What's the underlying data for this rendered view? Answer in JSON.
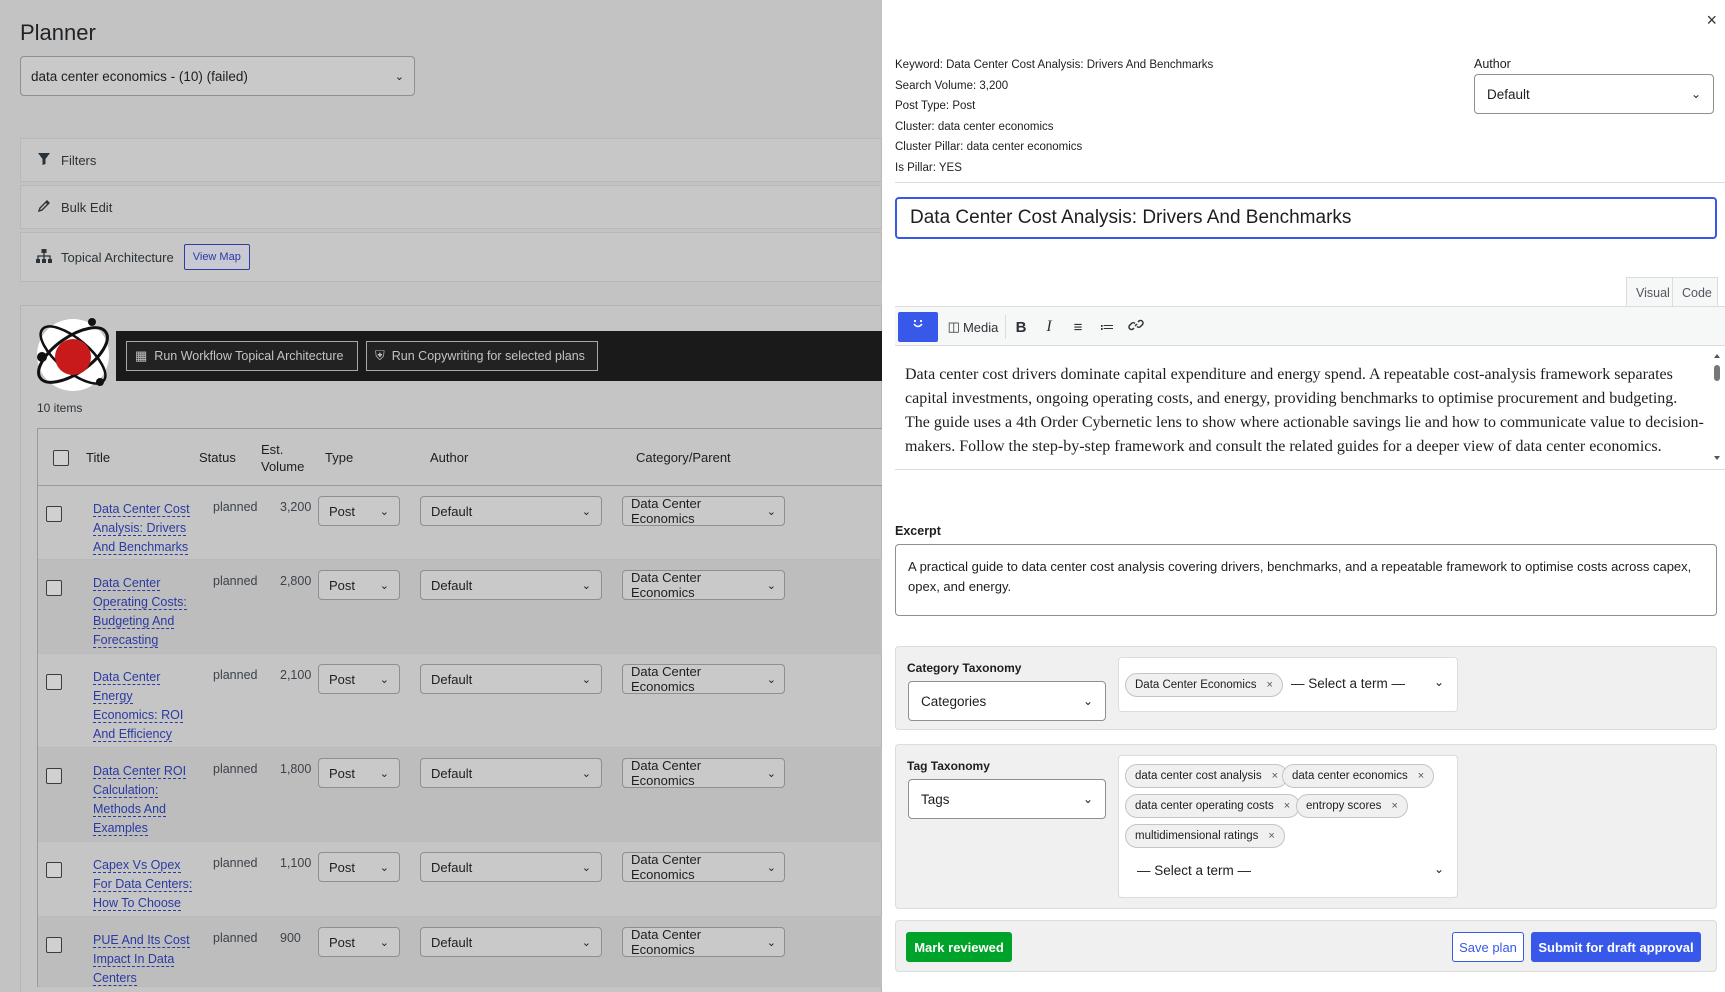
{
  "planner": {
    "title": "Planner",
    "plan_select": "data center economics - (10) (failed)",
    "filters_label": "Filters",
    "bulk_edit_label": "Bulk Edit",
    "topical_label": "Topical Architecture",
    "view_map_label": "View Map",
    "run_workflow_label": "Run Workflow Topical Architecture",
    "run_copy_label": "Run Copywriting for selected plans",
    "items_count": "10 items",
    "columns": {
      "title": "Title",
      "status": "Status",
      "volume_line1": "Est.",
      "volume_line2": "Volume",
      "type": "Type",
      "author": "Author",
      "category": "Category/Parent"
    },
    "rows": [
      {
        "title": "Data Center Cost Analysis: Drivers And Benchmarks",
        "status": "planned",
        "volume": "3,200",
        "type": "Post",
        "author": "Default",
        "category": "Data Center Economics"
      },
      {
        "title": "Data Center Operating Costs: Budgeting And Forecasting",
        "status": "planned",
        "volume": "2,800",
        "type": "Post",
        "author": "Default",
        "category": "Data Center Economics"
      },
      {
        "title": "Data Center Energy Economics: ROI And Efficiency",
        "status": "planned",
        "volume": "2,100",
        "type": "Post",
        "author": "Default",
        "category": "Data Center Economics"
      },
      {
        "title": "Data Center ROI Calculation: Methods And Examples",
        "status": "planned",
        "volume": "1,800",
        "type": "Post",
        "author": "Default",
        "category": "Data Center Economics"
      },
      {
        "title": "Capex Vs Opex For Data Centers: How To Choose",
        "status": "planned",
        "volume": "1,100",
        "type": "Post",
        "author": "Default",
        "category": "Data Center Economics"
      },
      {
        "title": "PUE And Its Cost Impact In Data Centers",
        "status": "planned",
        "volume": "900",
        "type": "Post",
        "author": "Default",
        "category": "Data Center Economics"
      }
    ]
  },
  "drawer": {
    "close": "×",
    "meta": {
      "keyword": "Keyword: Data Center Cost Analysis: Drivers And Benchmarks",
      "volume": "Search Volume: 3,200",
      "post_type": "Post Type: Post",
      "cluster": "Cluster: data center economics",
      "pillar": "Cluster Pillar: data center economics",
      "is_pillar": "Is Pillar: YES"
    },
    "author_label": "Author",
    "author_value": "Default",
    "title_value": "Data Center Cost Analysis: Drivers And Benchmarks",
    "tab_visual": "Visual",
    "tab_code": "Code",
    "media_label": "Media",
    "content": "Data center cost drivers dominate capital expenditure and energy spend. A repeatable cost-analysis framework separates capital investments, ongoing operating costs, and energy, providing benchmarks to optimise procurement and budgeting. The guide uses a 4th Order Cybernetic lens to show where actionable savings lie and how to communicate value to decision-makers. Follow the step-by-step framework and consult the related guides for a deeper view of data center economics.",
    "excerpt_label": "Excerpt",
    "excerpt": "A practical guide to data center cost analysis covering drivers, benchmarks, and a repeatable framework to optimise costs across capex, opex, and energy.",
    "category_taxonomy_label": "Category Taxonomy",
    "category_taxonomy_value": "Categories",
    "category_terms": [
      "Data Center Economics"
    ],
    "select_term": "— Select a term —",
    "tag_taxonomy_label": "Tag Taxonomy",
    "tag_taxonomy_value": "Tags",
    "tag_terms": [
      "data center cost analysis",
      "data center economics",
      "data center operating costs",
      "entropy scores",
      "multidimensional ratings"
    ],
    "mark_reviewed": "Mark reviewed",
    "save_plan": "Save plan",
    "submit": "Submit for draft approval"
  },
  "colors": {
    "accent": "#3858e9",
    "green": "#00a32a",
    "link": "#2a3aa3"
  }
}
